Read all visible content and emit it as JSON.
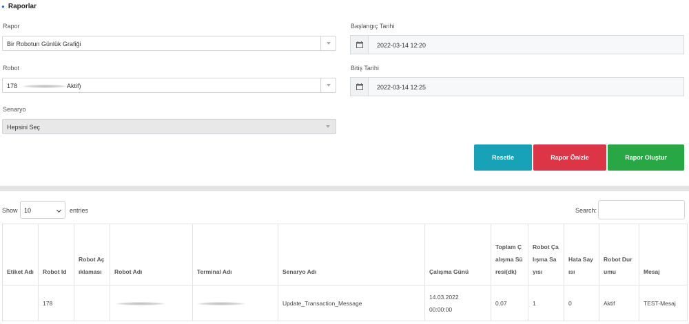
{
  "header": {
    "title": "Raporlar"
  },
  "form": {
    "rapor": {
      "label": "Rapor",
      "value": "Bir Robotun Günlük Grafiği"
    },
    "robot": {
      "label": "Robot",
      "value_prefix": "178",
      "value_suffix": "Aktif)"
    },
    "senaryo": {
      "label": "Senaryo",
      "value": "Hepsini Seç"
    },
    "start_date": {
      "label": "Başlangıç Tarihi",
      "value": "2022-03-14 12:20"
    },
    "end_date": {
      "label": "Bitiş Tarihi",
      "value": "2022-03-14 12:25"
    }
  },
  "buttons": {
    "reset": "Resetle",
    "preview": "Rapor Önizle",
    "create": "Rapor Oluştur"
  },
  "table_controls": {
    "show_label": "Show",
    "entries_value": "10",
    "entries_label": "entries",
    "search_label": "Search:"
  },
  "table": {
    "columns": [
      "Etiket Adı",
      "Robot Id",
      "Robot Açıklaması",
      "Robot Adı",
      "Terminal Adı",
      "Senaryo Adı",
      "Çalışma Günü",
      "Toplam Çalışma Süresi(dk)",
      "Robot Çalışma Sayısı",
      "Hata Sayısı",
      "Robot Durumu",
      "Mesaj"
    ],
    "rows": [
      {
        "etiket": "",
        "robot_id": "178",
        "aciklama": "",
        "robot_adi": "",
        "terminal": "",
        "senaryo": "Update_Transaction_Message",
        "gun_date": "14.03.2022",
        "gun_time": "00:00:00",
        "sure": "0,07",
        "calisma": "1",
        "hata": "0",
        "durum": "Aktif",
        "mesaj": "TEST-Mesaj"
      }
    ]
  },
  "colors": {
    "reset": "#17a2b8",
    "preview": "#dc3545",
    "create": "#28a745",
    "accent": "#2a6ed8"
  }
}
